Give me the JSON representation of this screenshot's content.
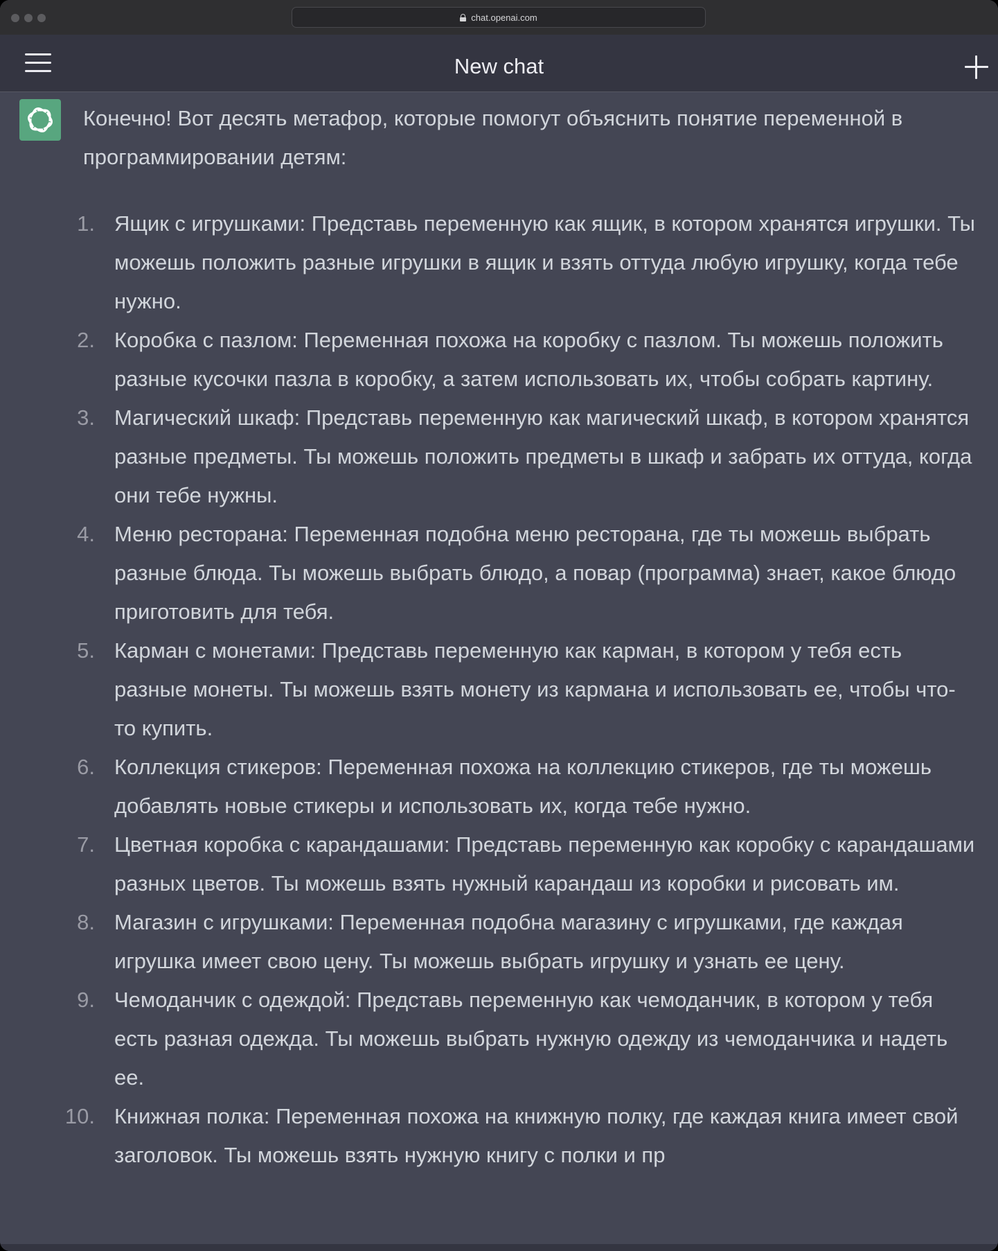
{
  "browser": {
    "url": "chat.openai.com"
  },
  "header": {
    "title": "New chat",
    "menu_icon": "hamburger-menu-icon",
    "new_chat_icon": "plus-icon"
  },
  "message": {
    "avatar_icon": "openai-logo-icon",
    "intro": "Конечно! Вот десять метафор, которые помогут объяснить понятие переменной в программировании детям:",
    "items": [
      {
        "num": "1.",
        "text": "Ящик с игрушками: Представь переменную как ящик, в котором хранятся игрушки. Ты можешь положить разные игрушки в ящик и взять оттуда любую игрушку, когда тебе нужно."
      },
      {
        "num": "2.",
        "text": "Коробка с пазлом: Переменная похожа на коробку с пазлом. Ты можешь положить разные кусочки пазла в коробку, а затем использовать их, чтобы собрать картину."
      },
      {
        "num": "3.",
        "text": "Магический шкаф: Представь переменную как магический шкаф, в котором хранятся разные предметы. Ты можешь положить предметы в шкаф и забрать их оттуда, когда они тебе нужны."
      },
      {
        "num": "4.",
        "text": "Меню ресторана: Переменная подобна меню ресторана, где ты можешь выбрать разные блюда. Ты можешь выбрать блюдо, а повар (программа) знает, какое блюдо приготовить для тебя."
      },
      {
        "num": "5.",
        "text": "Карман с монетами: Представь переменную как карман, в котором у тебя есть разные монеты. Ты можешь взять монету из кармана и использовать ее, чтобы что-то купить."
      },
      {
        "num": "6.",
        "text": "Коллекция стикеров: Переменная похожа на коллекцию стикеров, где ты можешь добавлять новые стикеры и использовать их, когда тебе нужно."
      },
      {
        "num": "7.",
        "text": "Цветная коробка с карандашами: Представь переменную как коробку с карандашами разных цветов. Ты можешь взять нужный карандаш из коробки и рисовать им."
      },
      {
        "num": "8.",
        "text": "Магазин с игрушками: Переменная подобна магазину с игрушками, где каждая игрушка имеет свою цену. Ты можешь выбрать игрушку и узнать ее цену."
      },
      {
        "num": "9.",
        "text": "Чемоданчик с одеждой: Представь переменную как чемоданчик, в котором у тебя есть разная одежда. Ты можешь выбрать нужную одежду из чемоданчика и надеть ее."
      },
      {
        "num": "10.",
        "text": "Книжная полка: Переменная похожа на книжную полку, где каждая книга имеет свой заголовок. Ты можешь взять нужную книгу с полки и пр"
      }
    ]
  },
  "scroll_button_icon": "arrow-down-icon",
  "colors": {
    "header_bg": "#343541",
    "chat_bg": "#444654",
    "text": "#d1d5db",
    "avatar_bg": "#58a67f"
  }
}
